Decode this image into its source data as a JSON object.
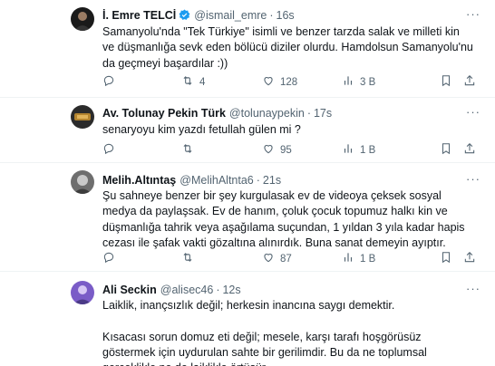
{
  "tweets": [
    {
      "name": "İ. Emre TELCİ",
      "handle": "@ismail_emre",
      "time": "16s",
      "text": "Samanyolu'nda \"Tek Türkiye\" isimli ve benzer tarzda salak ve milleti kin ve düşmanlığa sevk eden bölücü diziler olurdu. Hamdolsun Samanyolu'nu da geçmeyi başardılar :))",
      "replies": "",
      "retweets": "4",
      "likes": "128",
      "views": "3 B",
      "verified": true
    },
    {
      "name": "Av. Tolunay Pekin Türk",
      "handle": "@tolunaypekin",
      "time": "17s",
      "text": "senaryoyu kim yazdı fetullah gülen mi ?",
      "replies": "",
      "retweets": "",
      "likes": "95",
      "views": "1 B",
      "verified": false
    },
    {
      "name": "Melih.Altıntaş",
      "handle": "@MelihAltnta6",
      "time": "21s",
      "text": "Şu sahneye benzer bir şey kurgulasak ev de videoya çeksek sosyal medya da paylaşsak. Ev de hanım, çoluk çocuk topumuz halkı kin ve düşmanlığa tahrik veya aşağılama suçundan, 1 yıldan 3 yıla kadar hapis cezası ile şafak vakti gözaltına alınırdık. Buna sanat demeyin ayıptır.",
      "replies": "",
      "retweets": "",
      "likes": "87",
      "views": "1 B",
      "verified": false
    },
    {
      "name": "Ali Seckin",
      "handle": "@alisec46",
      "time": "12s",
      "text": "Laiklik, inançsızlık değil; herkesin inancına saygı demektir.\n\nKısacası sorun domuz eti değil; mesele, karşı tarafı hoşgörüsüz göstermek için uydurulan sahte bir gerilimdir. Bu da ne toplumsal gerçeklikle ne de laiklikle örtüşür.",
      "replies": "",
      "retweets": "",
      "likes": "",
      "views": "",
      "verified": false
    }
  ],
  "colors": {
    "verified": "#1d9bf0",
    "text": "#0f1419",
    "muted": "#536471",
    "border": "#eff3f4"
  },
  "icons": [
    "more-icon",
    "reply-icon",
    "retweet-icon",
    "like-icon",
    "views-icon",
    "bookmark-icon",
    "share-icon"
  ]
}
